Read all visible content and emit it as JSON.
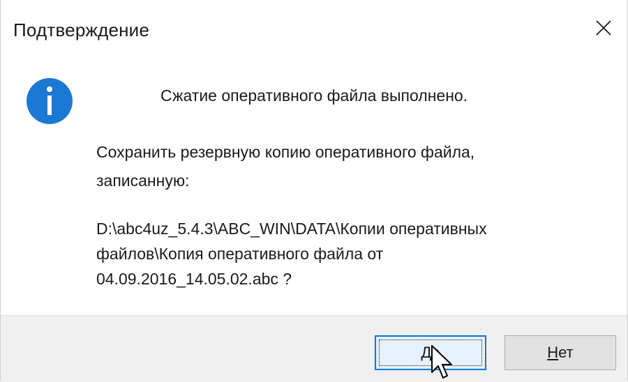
{
  "window": {
    "title": "Подтверждение",
    "close_icon": "close-icon"
  },
  "message": {
    "icon": "info-icon",
    "icon_color": "#1b78d3",
    "line1": "Сжатие оперативного файла выполнено.",
    "question_line1": "Сохранить резервную копию оперативного файла,",
    "question_line2": "записанную:",
    "path_line1": "D:\\abc4uz_5.4.3\\ABC_WIN\\DATA\\Копии оперативных",
    "path_line2": "файлов\\Копия оперативного файла от",
    "path_line3": "04.09.2016_14.05.02.abc ?"
  },
  "buttons": {
    "yes": {
      "access_key": "Д",
      "rest": "а"
    },
    "no": {
      "access_key": "Н",
      "rest": "ет"
    }
  },
  "colors": {
    "accent": "#0078d7",
    "footer_bg": "#f0f0f0"
  }
}
